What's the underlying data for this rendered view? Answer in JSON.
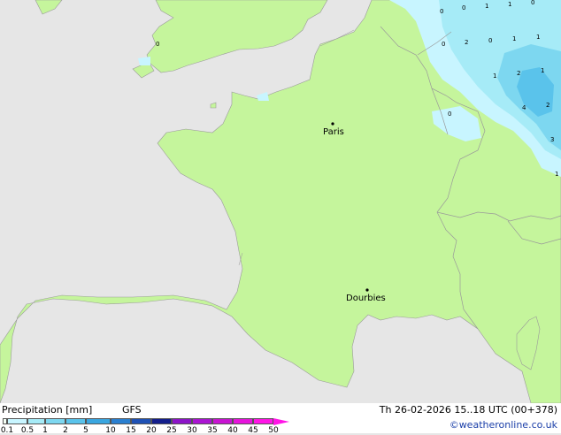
{
  "map": {
    "cities": [
      {
        "name": "Paris"
      },
      {
        "name": "Dourbies"
      }
    ],
    "precip_labels": [
      "0",
      "0",
      "1",
      "1",
      "0",
      "0",
      "2",
      "0",
      "1",
      "1",
      "1",
      "2",
      "1",
      "4",
      "2",
      "0",
      "3",
      "1",
      "0"
    ]
  },
  "legend": {
    "title": "Precipitation [mm]",
    "model": "GFS",
    "datetime": "Th 26-02-2026 15..18 UTC (00+378)",
    "credit": "©weatheronline.co.uk",
    "ticks": [
      "0.1",
      "0.5",
      "1",
      "2",
      "5",
      "10",
      "15",
      "20",
      "25",
      "30",
      "35",
      "40",
      "45",
      "50"
    ],
    "colors": [
      "#f5fff5",
      "#c8f5ff",
      "#a6ebf7",
      "#7dd7f0",
      "#5ac3eb",
      "#3aa6e0",
      "#2a7fd0",
      "#1e50b4",
      "#141e8c",
      "#8c14c8",
      "#aa14d2",
      "#c814d2",
      "#e614dc",
      "#ff14e6"
    ]
  }
}
